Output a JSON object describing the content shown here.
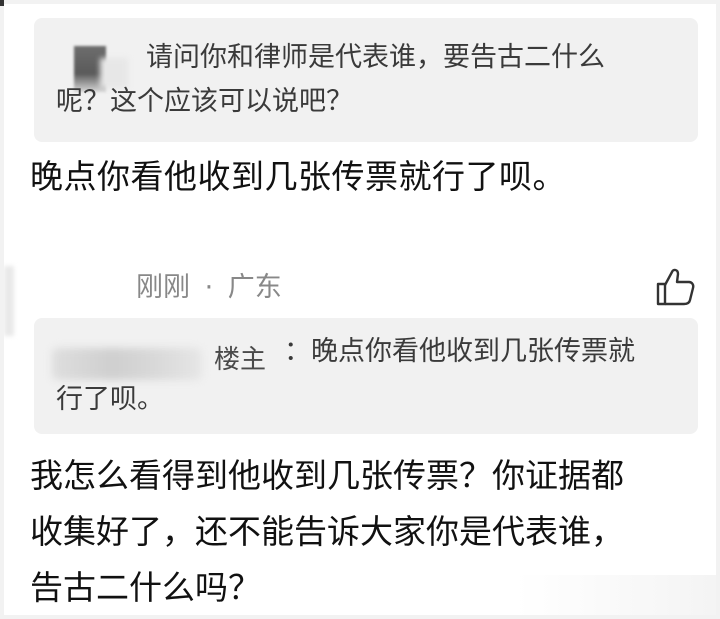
{
  "quoted_comment": {
    "line1": "请问你和律师是代表谁，要告古二什么",
    "line2": "呢？这个应该可以说吧？"
  },
  "op_reply": "晚点你看他收到几张传票就行了呗。",
  "comment": {
    "time": "刚刚",
    "separator": "·",
    "location": "广东",
    "like_icon": "thumbs-up-icon"
  },
  "quoted_op": {
    "tag": "楼主",
    "line1": "：晚点你看他收到几张传票就",
    "line2": "行了呗。"
  },
  "reply": {
    "line1": "我怎么看得到他收到几张传票？你证据都",
    "line2": "收集好了，还不能告诉大家你是代表谁，",
    "line3": "告古二什么吗？"
  },
  "colors": {
    "quote_bg": "#f1f1f1",
    "meta_text": "#888888",
    "body_text": "#111111"
  }
}
